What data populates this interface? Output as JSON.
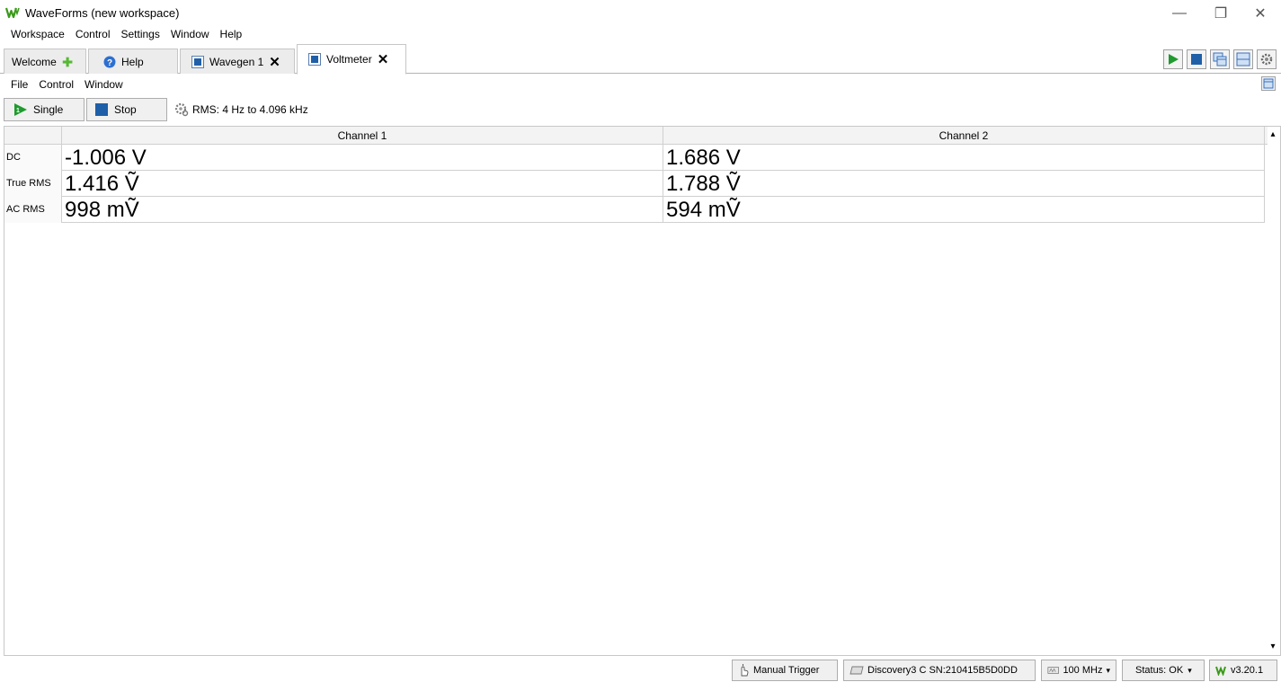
{
  "window": {
    "title": "WaveForms (new workspace)",
    "minimize_glyph": "—",
    "restore_glyph": "❐",
    "close_glyph": "✕"
  },
  "menubar": [
    "Workspace",
    "Control",
    "Settings",
    "Window",
    "Help"
  ],
  "tabs": [
    {
      "label": "Welcome",
      "icon": "green-plus-icon"
    },
    {
      "label": "Help",
      "icon": "help-circle-icon"
    },
    {
      "label": "Wavegen 1",
      "icon": "blue-square-icon",
      "closable": true
    },
    {
      "label": "Voltmeter",
      "icon": "blue-square-icon",
      "closable": true,
      "active": true
    }
  ],
  "inner_menu": [
    "File",
    "Control",
    "Window"
  ],
  "toolbar": {
    "single_label": "Single",
    "stop_label": "Stop",
    "rms_label": "RMS: 4 Hz to 4.096 kHz"
  },
  "table": {
    "headers": [
      "Channel 1",
      "Channel 2"
    ],
    "rows": [
      {
        "label": "DC",
        "ch1": "-1.006 V",
        "ch2": "1.686 V"
      },
      {
        "label": "True RMS",
        "ch1": "1.416 Ṽ",
        "ch2": "1.788 Ṽ"
      },
      {
        "label": "AC RMS",
        "ch1": "998 mṼ",
        "ch2": "594 mṼ"
      }
    ]
  },
  "statusbar": {
    "manual_trigger": "Manual Trigger",
    "device": "Discovery3 C SN:210415B5D0DD",
    "clock": "100 MHz",
    "status": "Status: OK",
    "version": "v3.20.1"
  },
  "colors": {
    "accent_green": "#1e9a2e",
    "accent_blue": "#1f5fa8",
    "logo_green": "#3a9a1a"
  }
}
